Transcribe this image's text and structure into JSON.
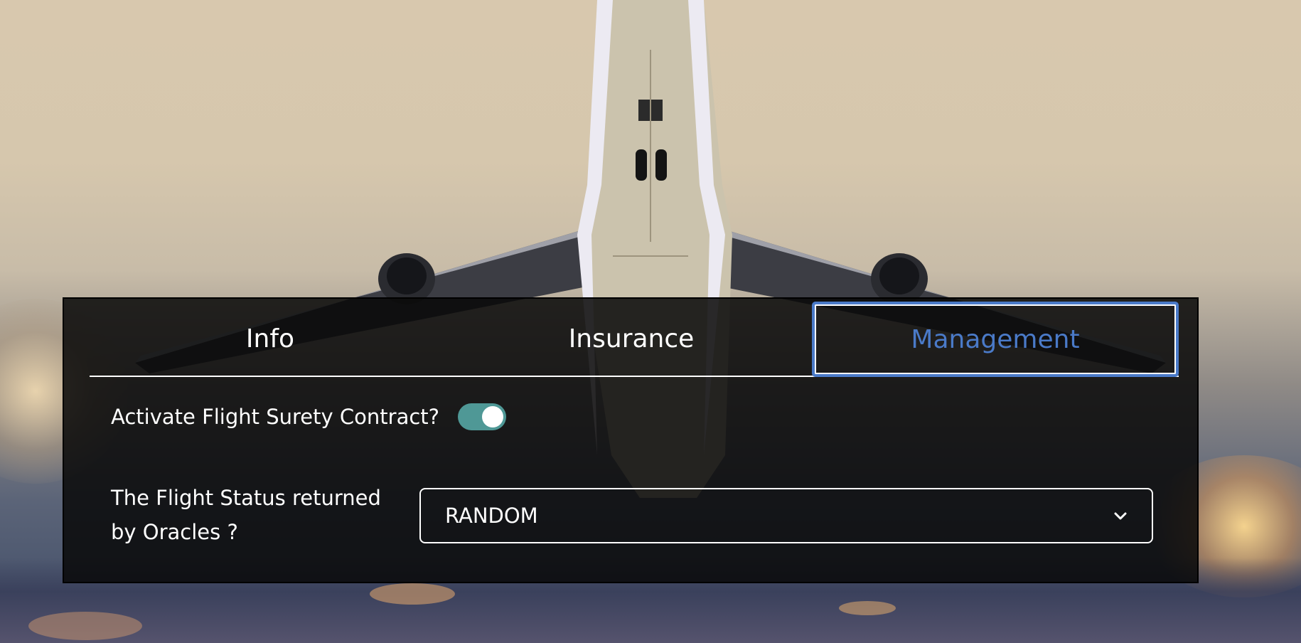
{
  "tabs": [
    {
      "label": "Info",
      "active": false
    },
    {
      "label": "Insurance",
      "active": false
    },
    {
      "label": "Management",
      "active": true
    }
  ],
  "management": {
    "activate_label": "Activate Flight Surety Contract?",
    "activate_enabled": true,
    "status_label": "The Flight Status returned by Oracles ?",
    "status_selected": "RANDOM"
  },
  "colors": {
    "active_tab": "#4a7ac8",
    "toggle_on": "#4f9896",
    "panel_bg": "#080808"
  },
  "icons": {
    "select": "chevron-down-icon"
  }
}
